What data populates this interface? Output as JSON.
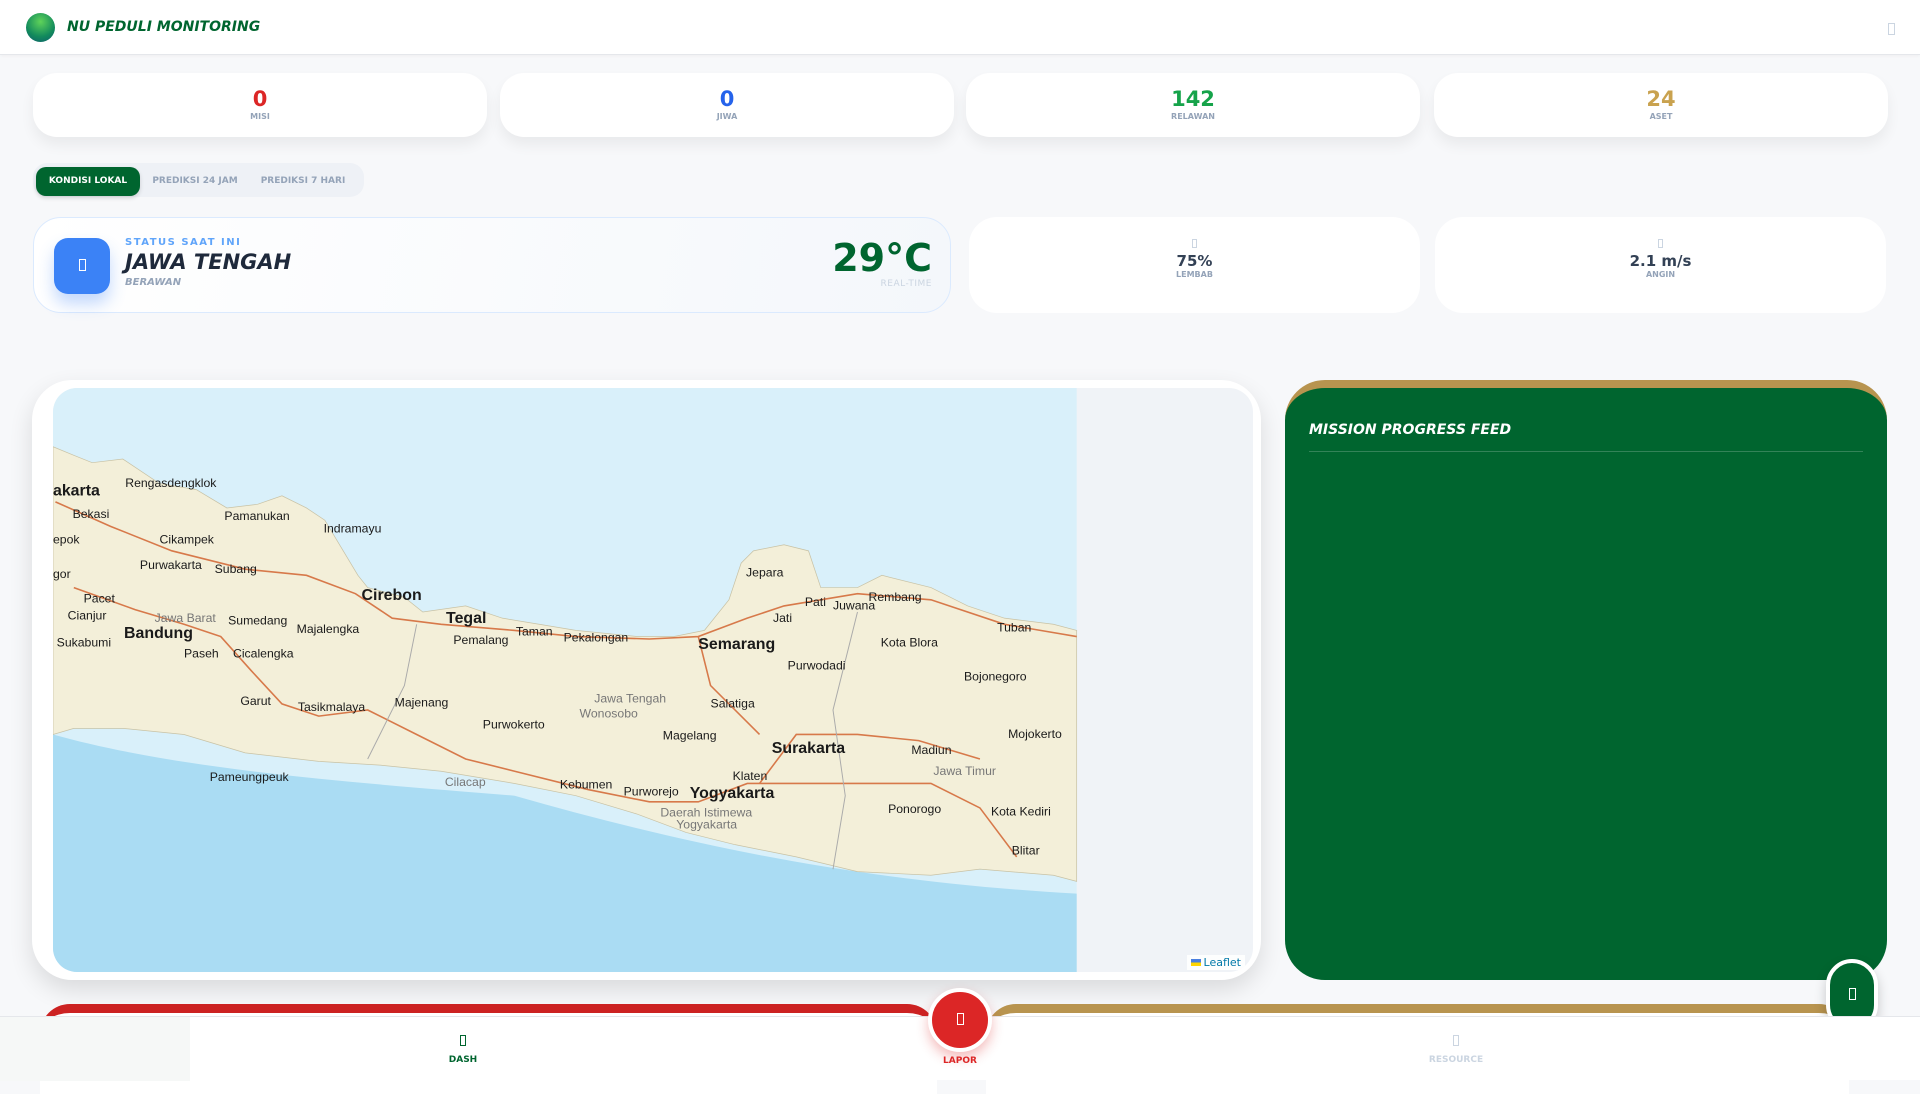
{
  "header": {
    "title": "NU PEDULI MONITORING",
    "menu_icon": "bars-icon"
  },
  "stats": [
    {
      "value": "0",
      "label": "MISI",
      "color": "#dc2626"
    },
    {
      "value": "0",
      "label": "JIWA",
      "color": "#2563eb"
    },
    {
      "value": "142",
      "label": "RELAWAN",
      "color": "#16a34a"
    },
    {
      "value": "24",
      "label": "ASET",
      "color": "#c9a24f"
    }
  ],
  "tabs": [
    {
      "label": "KONDISI LOKAL",
      "active": true
    },
    {
      "label": "PREDIKSI 24 JAM"
    },
    {
      "label": "PREDIKSI 7 HARI"
    }
  ],
  "weather": {
    "status_label": "STATUS SAAT INI",
    "region": "JAWA TENGAH",
    "condition": "BERAWAN",
    "temperature": "29°C",
    "realtime_label": "REAL-TIME",
    "icon": "cloud-icon"
  },
  "metrics": [
    {
      "value": "75%",
      "label": "LEMBAB",
      "icon": "droplet-icon"
    },
    {
      "value": "2.1 m/s",
      "label": "ANGIN",
      "icon": "wind-icon"
    }
  ],
  "map": {
    "attribution": "Leaflet",
    "labels": [
      "akarta",
      "Rengasdengklok",
      "Bekasi",
      "epok",
      "Pamanukan",
      "Indramayu",
      "Cikampek",
      "Purwakarta",
      "Subang",
      "Cirebon",
      "gor",
      "Pacet",
      "Cianjur",
      "Jawa Barat",
      "Sumedang",
      "Majalengka",
      "Bandung",
      "Tegal",
      "Taman",
      "Pemalang",
      "Pekalongan",
      "Sukabumi",
      "Paseh",
      "Cicalengka",
      "Semarang",
      "Jepara",
      "Pati",
      "Juwana",
      "Rembang",
      "Jati",
      "Tuban",
      "Kota Blora",
      "Purwodadi",
      "Bojonegoro",
      "Garut",
      "Tasikmalaya",
      "Majenang",
      "Jawa Tengah",
      "Wonosobo",
      "Salatiga",
      "Purwokerto",
      "Magelang",
      "Surakarta",
      "Madiun",
      "Mojokerto",
      "Jawa Timur",
      "Pameungpeuk",
      "Cilacap",
      "Kebumen",
      "Klaten",
      "Purworejo",
      "Yogyakarta",
      "Ponorogo",
      "Kota Kediri",
      "Daerah Istimewa",
      "Yogyakarta",
      "Blitar"
    ]
  },
  "feed": {
    "title": "MISSION PROGRESS FEED"
  },
  "nav": {
    "dash": "DASH",
    "lapor": "LAPOR",
    "resource": "RESOURCE"
  },
  "colors": {
    "brand": "#00652f",
    "gold": "#b8944f",
    "danger": "#dc2626"
  }
}
